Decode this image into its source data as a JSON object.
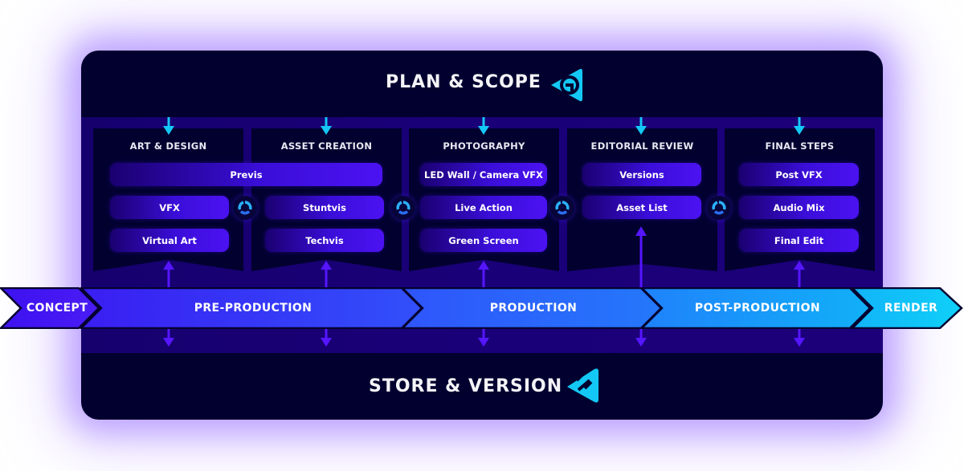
{
  "diagram": {
    "top_title": "PLAN & SCOPE",
    "bottom_title": "STORE & VERSION",
    "top_logo": "play-triangle-logo-icon",
    "bottom_logo": "h-triangle-logo-icon",
    "colors": {
      "background": "#02002f",
      "band": "#1a0078",
      "pill": "#4b12f2",
      "accent_cyan": "#14c8f5",
      "arrow_violet": "#5516ff"
    },
    "columns": [
      {
        "title": "ART & DESIGN",
        "items": [
          "VFX",
          "Virtual Art"
        ]
      },
      {
        "title": "ASSET CREATION",
        "items": [
          "Stuntvis",
          "Techvis"
        ]
      },
      {
        "title": "PHOTOGRAPHY",
        "items": [
          "LED Wall / Camera VFX",
          "Live Action",
          "Green Screen"
        ]
      },
      {
        "title": "EDITORIAL REVIEW",
        "items": [
          "Versions",
          "Asset List"
        ]
      },
      {
        "title": "FINAL STEPS",
        "items": [
          "Post VFX",
          "Audio Mix",
          "Final Edit"
        ]
      }
    ],
    "shared_item": "Previs",
    "cycle_icon": "cycle-arrows-icon",
    "stages": [
      "CONCEPT",
      "PRE-PRODUCTION",
      "PRODUCTION",
      "POST-PRODUCTION",
      "RENDER"
    ]
  }
}
